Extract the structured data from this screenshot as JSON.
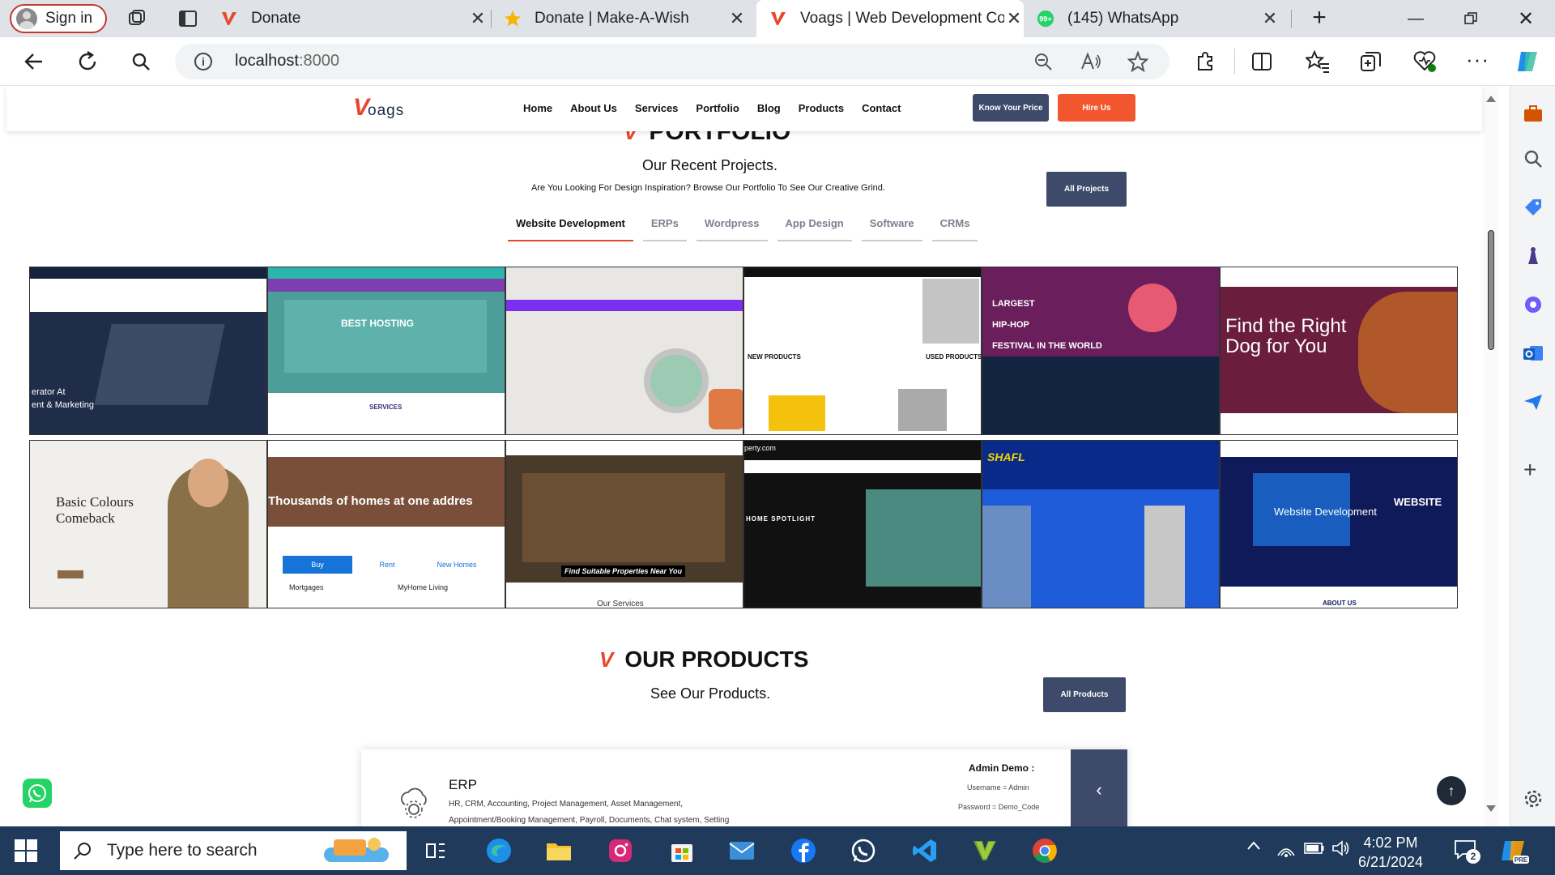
{
  "browser": {
    "signin_label": "Sign in",
    "tabs": [
      {
        "title": "Donate",
        "favicon": "voags-v-icon",
        "active": false
      },
      {
        "title": "Donate | Make-A-Wish",
        "favicon": "star-icon",
        "active": false
      },
      {
        "title": "Voags | Web Development Co",
        "favicon": "voags-v-icon",
        "active": true
      },
      {
        "title": "(145) WhatsApp",
        "favicon": "whatsapp-icon",
        "active": false
      }
    ],
    "whatsapp_badge": "99+",
    "new_tab_label": "+",
    "close_glyph": "✕",
    "address": {
      "host": "localhost",
      "port": ":8000"
    }
  },
  "site": {
    "logo": {
      "mark": "V",
      "rest": "oags"
    },
    "nav": [
      "Home",
      "About Us",
      "Services",
      "Portfolio",
      "Blog",
      "Products",
      "Contact"
    ],
    "know_price_label": "Know Your Price",
    "hire_label": "Hire Us",
    "portfolio": {
      "title": "PORTFOLIO",
      "subtitle": "Our Recent Projects.",
      "text": "Are You Looking For Design Inspiration? Browse Our Portfolio To See Our Creative Grind.",
      "all_label": "All Projects",
      "filters": [
        "Website Development",
        "ERPs",
        "Wordpress",
        "App Design",
        "Software",
        "CRMs"
      ],
      "active_filter": "Website Development",
      "thumbs": [
        {
          "caption": "erator At\nent & Marketing",
          "bg": "#1f2c4a"
        },
        {
          "caption": "BEST HOSTING",
          "bg": "#4d9e9b",
          "sub": "SERVICES"
        },
        {
          "caption": "",
          "bg": "#e9e7e3"
        },
        {
          "caption": "NEW PRODUCTS",
          "bg": "#ffffff",
          "sub": "USED PRODUCTS"
        },
        {
          "caption": "LARGEST\nHIP-HOP\nFESTIVAL IN THE WORLD",
          "bg": "#6a1e5c"
        },
        {
          "caption": "Find the Right\nDog for You",
          "bg": "#6b1d3e"
        },
        {
          "caption": "Basic Colours\nComeback",
          "bg": "#f1efec"
        },
        {
          "caption": "Thousands of homes at one addres",
          "bg": "#7a4f3a",
          "tabs": [
            "Buy",
            "Rent",
            "New Homes"
          ],
          "lines": [
            "Mortgages",
            "MyHome Living"
          ]
        },
        {
          "caption": "Find Suitable Properties Near You",
          "bg": "#4a3a2a",
          "sub": "Our Services"
        },
        {
          "caption": "HOME SPOTLIGHT",
          "bg": "#111111",
          "sub": "perty.com"
        },
        {
          "caption": "SHAFL",
          "bg": "#1d5bd8"
        },
        {
          "caption": "Website Development",
          "bg": "#0e1a5a",
          "sub": "ABOUT US",
          "badge": "WEBSITE"
        }
      ]
    },
    "products": {
      "title": "OUR PRODUCTS",
      "subtitle": "See Our Products.",
      "all_label": "All Products",
      "card": {
        "name": "ERP",
        "desc1": "HR, CRM, Accounting, Project Management, Asset Management,",
        "desc2": "Appointment/Booking Management, Payroll, Documents, Chat system, Setting",
        "admin_title": "Admin Demo :",
        "username": "Username = Admin",
        "password": "Password = Demo_Code",
        "arrow": "‹"
      }
    }
  },
  "taskbar": {
    "search_placeholder": "Type here to search",
    "time": "4:02 PM",
    "date": "6/21/2024",
    "notif_count": "2"
  },
  "colors": {
    "accent": "#e8452c",
    "navy": "#3e4a6a",
    "taskbar": "#1f3a5a"
  }
}
